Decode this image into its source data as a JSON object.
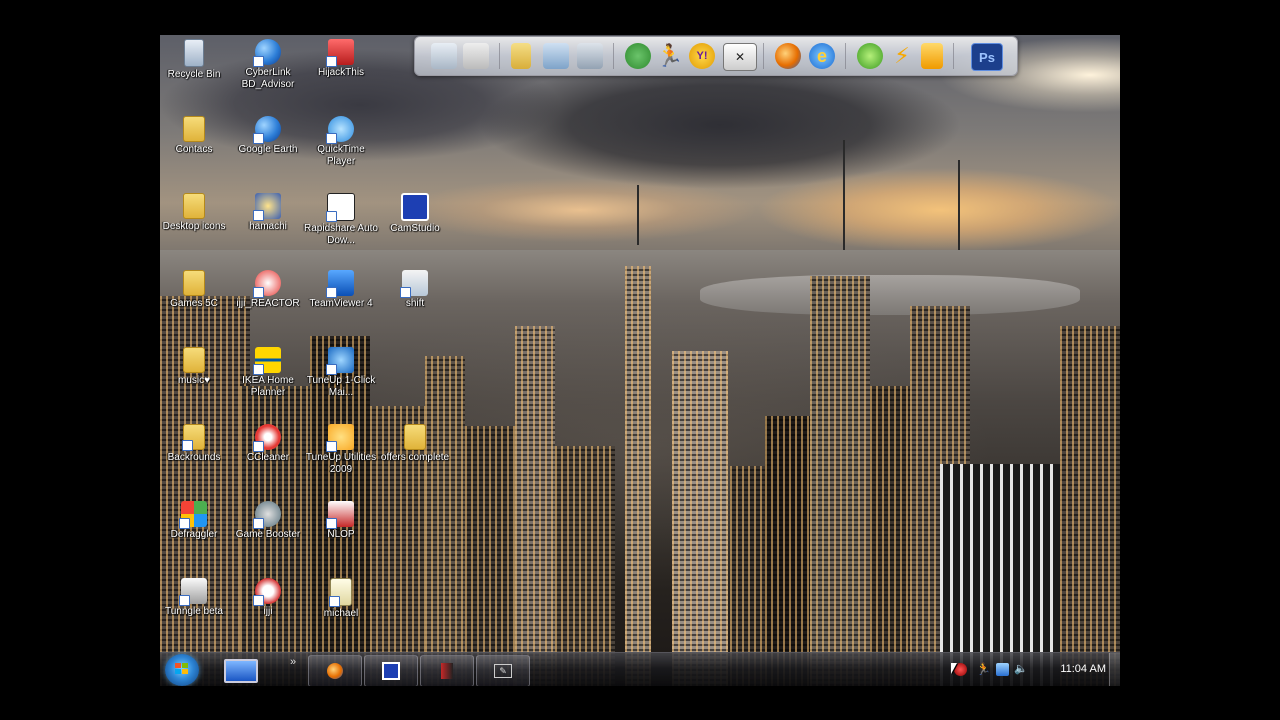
{
  "desktop": {
    "icons": [
      {
        "label": "Recycle Bin",
        "icon": "recycle-bin-icon"
      },
      {
        "label": "CyberLink BD_Advisor",
        "icon": "cyberlink-icon"
      },
      {
        "label": "HijackThis",
        "icon": "hijackthis-icon"
      },
      {
        "label": "Contacs",
        "icon": "folder-icon"
      },
      {
        "label": "Google Earth",
        "icon": "google-earth-icon"
      },
      {
        "label": "QuickTime Player",
        "icon": "quicktime-icon"
      },
      {
        "label": "Desktop icons",
        "icon": "folder-icon"
      },
      {
        "label": "hamachi",
        "icon": "hamachi-icon"
      },
      {
        "label": "Rapidshare Auto Dow...",
        "icon": "rapidshare-icon"
      },
      {
        "label": "CamStudio",
        "icon": "camstudio-icon"
      },
      {
        "label": "Games 5C",
        "icon": "folder-icon"
      },
      {
        "label": "ijji_REACTOR",
        "icon": "ijji-reactor-icon"
      },
      {
        "label": "TeamViewer 4",
        "icon": "teamviewer-icon"
      },
      {
        "label": "shift",
        "icon": "shift-icon"
      },
      {
        "label": "music♥",
        "icon": "folder-icon"
      },
      {
        "label": "IKEA Home Planner",
        "icon": "ikea-icon"
      },
      {
        "label": "TuneUp 1-Click Mai...",
        "icon": "tuneup-icon"
      },
      {
        "label": "Backrounds",
        "icon": "folder-icon"
      },
      {
        "label": "CCleaner",
        "icon": "ccleaner-icon"
      },
      {
        "label": "TuneUp Utilities 2009",
        "icon": "tuneup-utilities-icon"
      },
      {
        "label": "offers complete",
        "icon": "folder-icon"
      },
      {
        "label": "Defraggler",
        "icon": "defraggler-icon"
      },
      {
        "label": "Game Booster",
        "icon": "game-booster-icon"
      },
      {
        "label": "NLOP",
        "icon": "nlop-icon"
      },
      {
        "label": "Tunngle beta",
        "icon": "tunngle-icon"
      },
      {
        "label": "ijji",
        "icon": "ijji-icon"
      },
      {
        "label": "michael",
        "icon": "document-icon"
      }
    ]
  },
  "dock": {
    "icons": [
      "monitor-icon",
      "tools-icon",
      "folder-icon",
      "open-folder-icon",
      "drive-icon",
      "msn-icon",
      "aim-icon",
      "yahoo-messenger-icon",
      "xfire-icon",
      "firefox-icon",
      "internet-explorer-icon",
      "xbox-icon",
      "winamp-icon",
      "media-player-icon",
      "photoshop-icon"
    ],
    "yahoo_text": "Y!",
    "ps_text": "Ps"
  },
  "taskbar": {
    "quicklaunch_more": "»",
    "tasks": [
      "firefox-icon",
      "camstudio-icon",
      "tuneup-icon",
      "wacom-icon"
    ],
    "tray_icons": [
      "red-tray-icon",
      "aim-tray-icon",
      "network-icon",
      "volume-icon"
    ],
    "clock": "11:04 AM"
  }
}
